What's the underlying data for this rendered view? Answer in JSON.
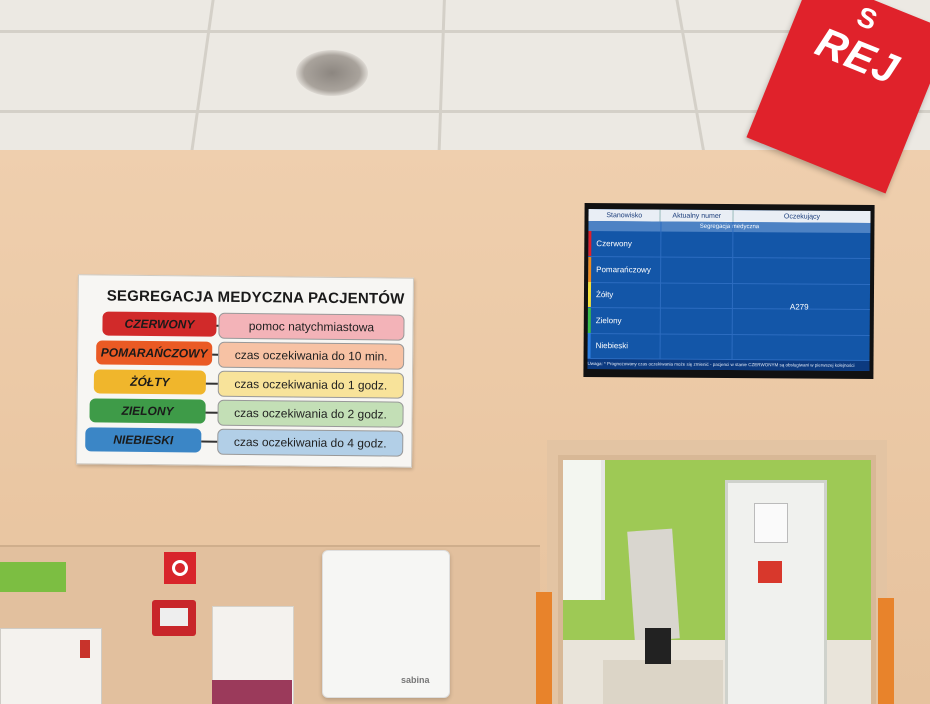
{
  "poster": {
    "title": "SEGREGACJA MEDYCZNA PACJENTÓW",
    "rows": [
      {
        "label": "CZERWONY",
        "desc": "pomoc natychmiastowa",
        "color": "#d12a2a",
        "light": "#f3b3b8"
      },
      {
        "label": "POMARAŃCZOWY",
        "desc": "czas oczekiwania do 10 min.",
        "color": "#ea5a24",
        "light": "#f7c2a4"
      },
      {
        "label": "ŻÓŁTY",
        "desc": "czas oczekiwania do 1 godz.",
        "color": "#f0b62c",
        "light": "#f8e39a"
      },
      {
        "label": "ZIELONY",
        "desc": "czas oczekiwania do 2 godz.",
        "color": "#3e9b48",
        "light": "#c3dfb6"
      },
      {
        "label": "NIEBIESKI",
        "desc": "czas oczekiwania do 4 godz.",
        "color": "#3b86c6",
        "light": "#b2cfe7"
      }
    ]
  },
  "screen": {
    "headers": [
      "Stanowisko",
      "Aktualny numer",
      "Oczekujący"
    ],
    "subheader": "Segregacja medyczna",
    "rows": [
      {
        "label": "Czerwony",
        "color": "#e0202a"
      },
      {
        "label": "Pomarańczowy",
        "color": "#f08a1c"
      },
      {
        "label": "Żółty",
        "color": "#f3e03a"
      },
      {
        "label": "Zielony",
        "color": "#3bbd4a"
      },
      {
        "label": "Niebieski",
        "color": "#2d7ee0"
      }
    ],
    "waiting_number": "A279",
    "footer": "Uwaga: * Prognozowany czas oczekiwania może się zmienić - pacjenci w stanie CZERWONYM są obsługiwani w pierwszej kolejności"
  },
  "red_sign": {
    "text": "REJ",
    "text_top": "S"
  },
  "dispenser": {
    "brand": "sabina"
  }
}
